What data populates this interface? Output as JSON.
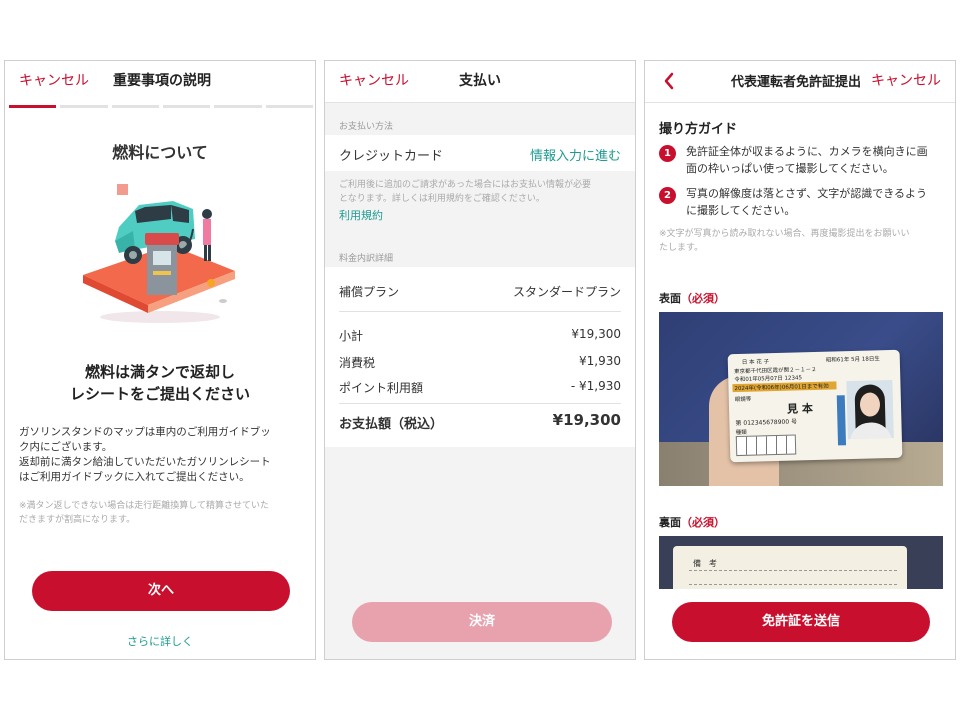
{
  "accent_color": "#c8102e",
  "disabled_color": "#e8a2ae",
  "screen1": {
    "cancel_label": "キャンセル",
    "title": "重要事項の説明",
    "progress_steps_total": 6,
    "progress_step_current": 1,
    "heading": "燃料について",
    "main_message_line1": "燃料は満タンで返却し",
    "main_message_line2": "レシートをご提出ください",
    "body_line1": "ガソリンスタンドのマップは車内のご利用ガイドブッ",
    "body_line2": "ク内にございます。",
    "body_line3": "返却前に満タン給油していただいたガソリンレシート",
    "body_line4": "はご利用ガイドブックに入れてご提出ください。",
    "note_line1": "※満タン返しできない場合は走行距離換算して精算させていた",
    "note_line2": "だきますが割高になります。",
    "next_button": "次へ",
    "more_link": "さらに詳しく"
  },
  "screen2": {
    "cancel_label": "キャンセル",
    "title": "支払い",
    "payment_method_label": "お支払い方法",
    "credit_card_label": "クレジットカード",
    "enter_info_link": "情報入力に進む",
    "notice_line1": "ご利用後に追加のご請求があった場合にはお支払い情報が必要",
    "notice_line2": "となります。詳しくは利用規約をご確認ください。",
    "terms_link": "利用規約",
    "breakdown_label": "料金内訳詳細",
    "plan_label": "補償プラン",
    "plan_value": "スタンダードプラン",
    "subtotal_label": "小計",
    "subtotal_value": "¥19,300",
    "tax_label": "消費税",
    "tax_value": "¥1,930",
    "points_label": "ポイント利用額",
    "points_value": "- ¥1,930",
    "total_label": "お支払額（税込）",
    "total_value": "¥19,300",
    "pay_button": "決済"
  },
  "screen3": {
    "back_icon": "chevron-left-icon",
    "title": "代表運転者免許証提出",
    "cancel_label": "キャンセル",
    "guide_heading": "撮り方ガイド",
    "step1_number": "1",
    "step1_line1": "免許証全体が収まるように、カメラを横向きに画",
    "step1_line2": "面の枠いっぱい使って撮影してください。",
    "step2_number": "2",
    "step2_line1": "写真の解像度は落とさず、文字が認識できるよう",
    "step2_line2": "に撮影してください。",
    "note_line1": "※文字が写真から読み取れない場合、再度撮影提出をお願いい",
    "note_line2": "たします。",
    "front_label": "表面",
    "back_label": "裏面",
    "required_label": "（必須）",
    "license": {
      "name": "日 本 花 子",
      "birth": "昭和61年 5月 18日生",
      "address": "東京都千代田区霞が関２－１－２",
      "issued": "令和01年05月07日 12345",
      "expiry": "2024年(令和06年)06月01日まで有効",
      "condition": "眼鏡等",
      "sample": "見 本",
      "number": "第 012345678900 号",
      "class_label": "種類",
      "back_field": "備　考"
    },
    "submit_button": "免許証を送信"
  }
}
